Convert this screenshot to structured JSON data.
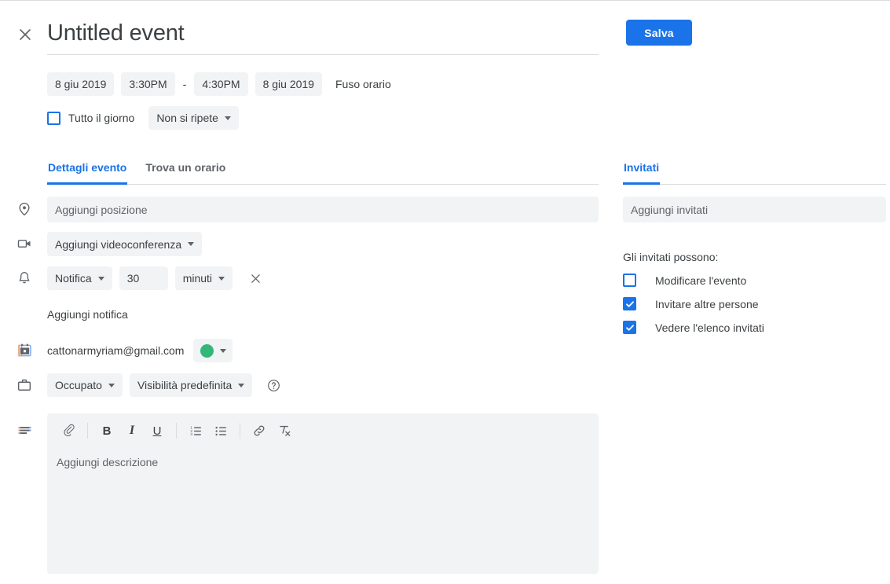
{
  "header": {
    "close_icon": "close-icon",
    "title": "Untitled event",
    "save_label": "Salva",
    "accent_color": "#1a73e8"
  },
  "schedule": {
    "start_date": "8 giu 2019",
    "start_time": "3:30PM",
    "separator": "-",
    "end_time": "4:30PM",
    "end_date": "8 giu 2019",
    "timezone_label": "Fuso orario",
    "all_day_label": "Tutto il giorno",
    "all_day_checked": false,
    "recurrence": "Non si ripete"
  },
  "tabs": {
    "left": [
      {
        "label": "Dettagli evento",
        "active": true
      },
      {
        "label": "Trova un orario",
        "active": false
      }
    ],
    "right": [
      {
        "label": "Invitati",
        "active": true
      }
    ]
  },
  "details": {
    "location": {
      "icon": "location-pin-icon",
      "placeholder": "Aggiungi posizione"
    },
    "conference": {
      "icon": "video-camera-icon",
      "label": "Aggiungi videoconferenza"
    },
    "notification": {
      "icon": "bell-icon",
      "type": "Notifica",
      "amount": "30",
      "unit": "minuti",
      "remove_icon": "close-icon",
      "add_label": "Aggiungi notifica"
    },
    "calendar": {
      "icon": "calendar-icon",
      "email": "cattonarmyriam@gmail.com",
      "color": "#33b679",
      "color_icon": "color-swatch-icon"
    },
    "availability": {
      "icon": "briefcase-icon",
      "busy": "Occupato",
      "visibility": "Visibilità predefinita",
      "help_icon": "help-circle-icon"
    },
    "description": {
      "icon": "description-lines-icon",
      "placeholder": "Aggiungi descrizione",
      "toolbar": [
        {
          "name": "attach-icon",
          "label": "Allega file"
        },
        {
          "name": "bold-icon",
          "label": "B"
        },
        {
          "name": "italic-icon",
          "label": "I"
        },
        {
          "name": "underline-icon",
          "label": "U"
        },
        {
          "name": "numbered-list-icon",
          "label": "Elenco numerato"
        },
        {
          "name": "bulleted-list-icon",
          "label": "Elenco puntato"
        },
        {
          "name": "link-icon",
          "label": "Inserisci link"
        },
        {
          "name": "clear-format-icon",
          "label": "Rimuovi formattazione"
        }
      ]
    }
  },
  "guests": {
    "placeholder": "Aggiungi invitati",
    "permissions_title": "Gli invitati possono:",
    "permissions": [
      {
        "label": "Modificare l'evento",
        "checked": false
      },
      {
        "label": "Invitare altre persone",
        "checked": true
      },
      {
        "label": "Vedere l'elenco invitati",
        "checked": true
      }
    ]
  }
}
